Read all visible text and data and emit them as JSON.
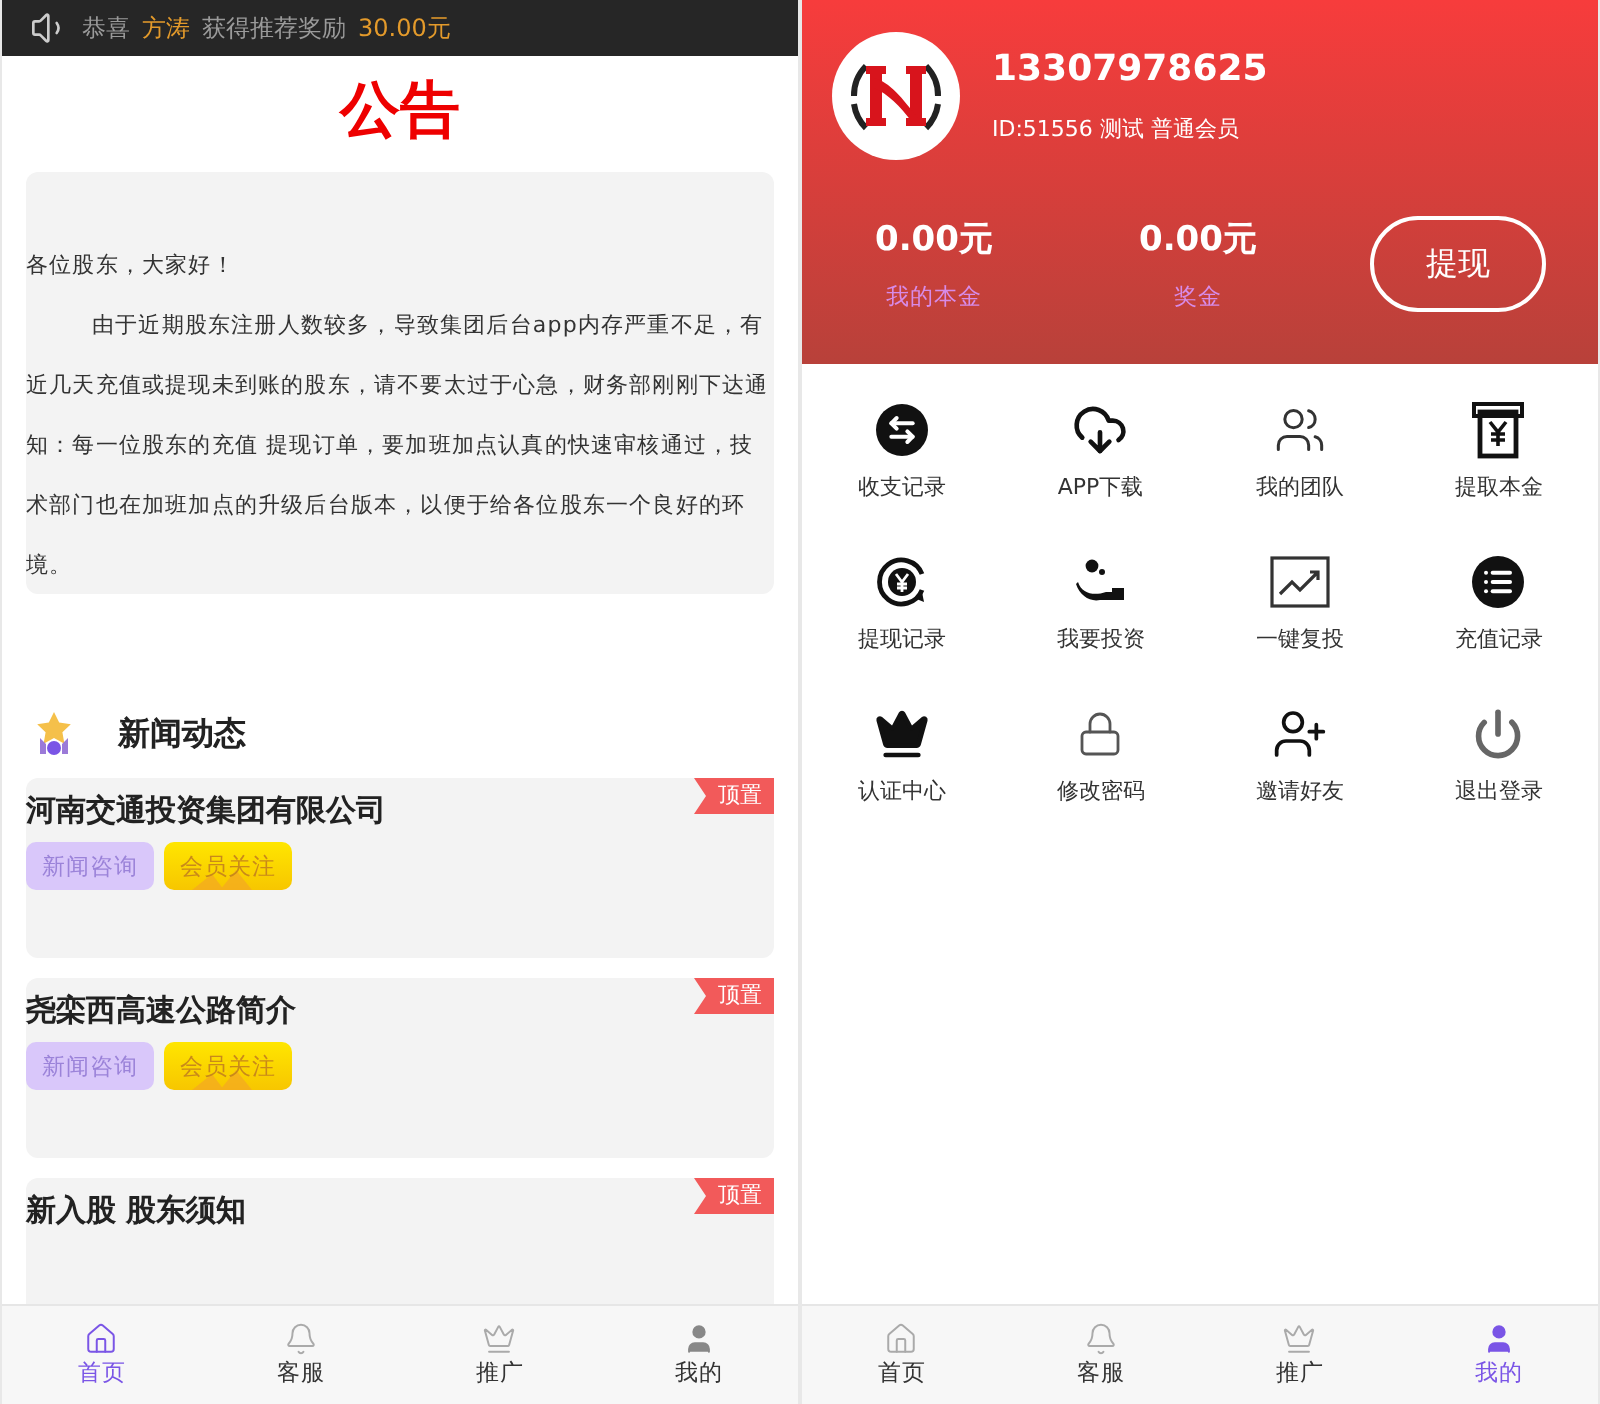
{
  "home": {
    "ticker": [
      {
        "text": "恭喜",
        "kind": "plain"
      },
      {
        "text": "方涛",
        "kind": "highlight"
      },
      {
        "text": "获得推荐奖励",
        "kind": "plain"
      },
      {
        "text": "30.00元",
        "kind": "highlight"
      }
    ],
    "notice_title": "公告",
    "notice": {
      "greeting": "各位股东，大家好！",
      "body": "由于近期股东注册人数较多，导致集团后台app内存严重不足，有近几天充值或提现未到账的股东，请不要太过于心急，财务部刚刚下达通知：每一位股东的充值 提现订单，要加班加点认真的快速审核通过，技术部门也在加班加点的升级后台版本，以便于给各位股东一个良好的环境。"
    },
    "news_title": "新闻动态",
    "news": [
      {
        "title": "河南交通投资集团有限公司",
        "badge": "顶置",
        "tags": [
          {
            "label": "新闻咨询",
            "kind": "purple"
          },
          {
            "label": "会员关注",
            "kind": "gold"
          }
        ]
      },
      {
        "title": "尧栾西高速公路简介",
        "badge": "顶置",
        "tags": [
          {
            "label": "新闻咨询",
            "kind": "purple"
          },
          {
            "label": "会员关注",
            "kind": "gold"
          }
        ]
      },
      {
        "title": "新入股 股东须知",
        "badge": "顶置"
      }
    ],
    "tab_bar": [
      {
        "label": "首页",
        "selected": true
      },
      {
        "label": "客服",
        "selected": false
      },
      {
        "label": "推广",
        "selected": false
      },
      {
        "label": "我的",
        "selected": false
      }
    ]
  },
  "profile": {
    "phone": "13307978625",
    "meta": "ID:51556 测试 普通会员",
    "balances": [
      {
        "amount": "0.00元",
        "label": "我的本金"
      },
      {
        "amount": "0.00元",
        "label": "奖金"
      }
    ],
    "withdraw_button": "提现",
    "menu": [
      {
        "label": "收支记录"
      },
      {
        "label": "APP下载"
      },
      {
        "label": "我的团队"
      },
      {
        "label": "提取本金"
      },
      {
        "label": "提现记录"
      },
      {
        "label": "我要投资"
      },
      {
        "label": "一键复投"
      },
      {
        "label": "充值记录"
      },
      {
        "label": "认证中心"
      },
      {
        "label": "修改密码"
      },
      {
        "label": "邀请好友"
      },
      {
        "label": "退出登录"
      }
    ],
    "tab_bar": [
      {
        "label": "首页",
        "selected": false
      },
      {
        "label": "客服",
        "selected": false
      },
      {
        "label": "推广",
        "selected": false
      },
      {
        "label": "我的",
        "selected": true
      }
    ]
  }
}
